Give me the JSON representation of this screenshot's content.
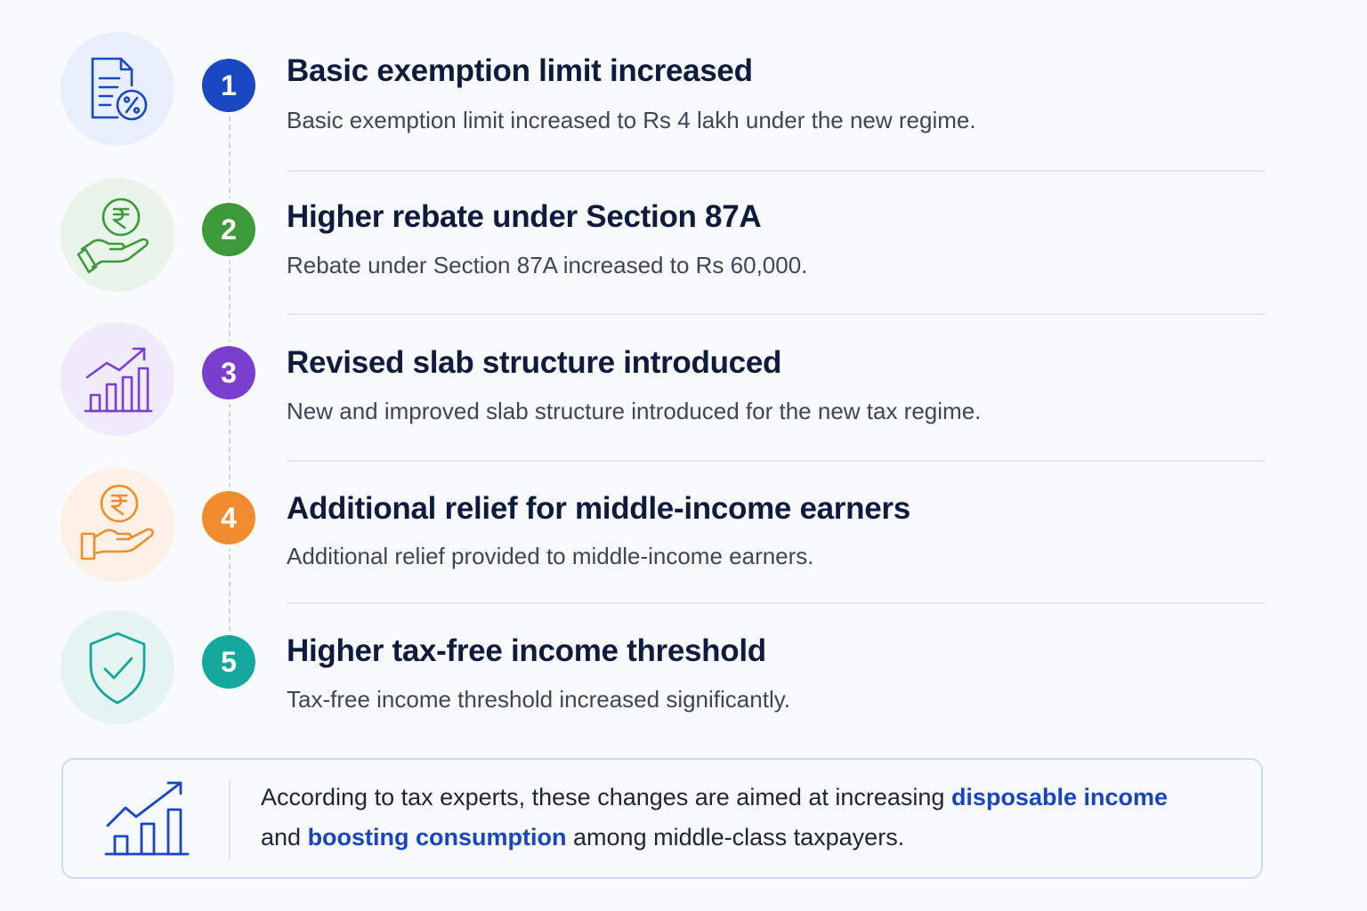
{
  "items": [
    {
      "number": "1",
      "icon": "document-percent-icon",
      "title": "Basic exemption limit increased",
      "description": "Basic exemption limit increased to Rs 4 lakh under the new regime.",
      "accent": "#1a47c2",
      "icon_bg": "#eaf0fb"
    },
    {
      "number": "2",
      "icon": "hand-rupee-icon",
      "title": "Higher rebate under Section 87A",
      "description": "Rebate under Section 87A increased to Rs 60,000.",
      "accent": "#3d9a3a",
      "icon_bg": "#e9f4ea"
    },
    {
      "number": "3",
      "icon": "bar-chart-growth-icon",
      "title": "Revised slab structure introduced",
      "description": "New and improved slab structure introduced for the new tax regime.",
      "accent": "#7b3fd0",
      "icon_bg": "#f0ebfa"
    },
    {
      "number": "4",
      "icon": "hand-rupee-coin-icon",
      "title": "Additional relief for middle-income earners",
      "description": "Additional relief provided to middle-income earners.",
      "accent": "#f08c2e",
      "icon_bg": "#fdf0e4"
    },
    {
      "number": "5",
      "icon": "shield-check-icon",
      "title": "Higher tax-free income threshold",
      "description": "Tax-free income threshold increased significantly.",
      "accent": "#13a89b",
      "icon_bg": "#e6f4f2"
    }
  ],
  "summary": {
    "icon": "growth-chart-icon",
    "text_1": "According to tax experts, these changes are aimed at increasing ",
    "highlight_1": "disposable income",
    "text_2": "and ",
    "highlight_2": "boosting consumption",
    "text_3": " among middle-class taxpayers.",
    "accent": "#1a45c0"
  }
}
